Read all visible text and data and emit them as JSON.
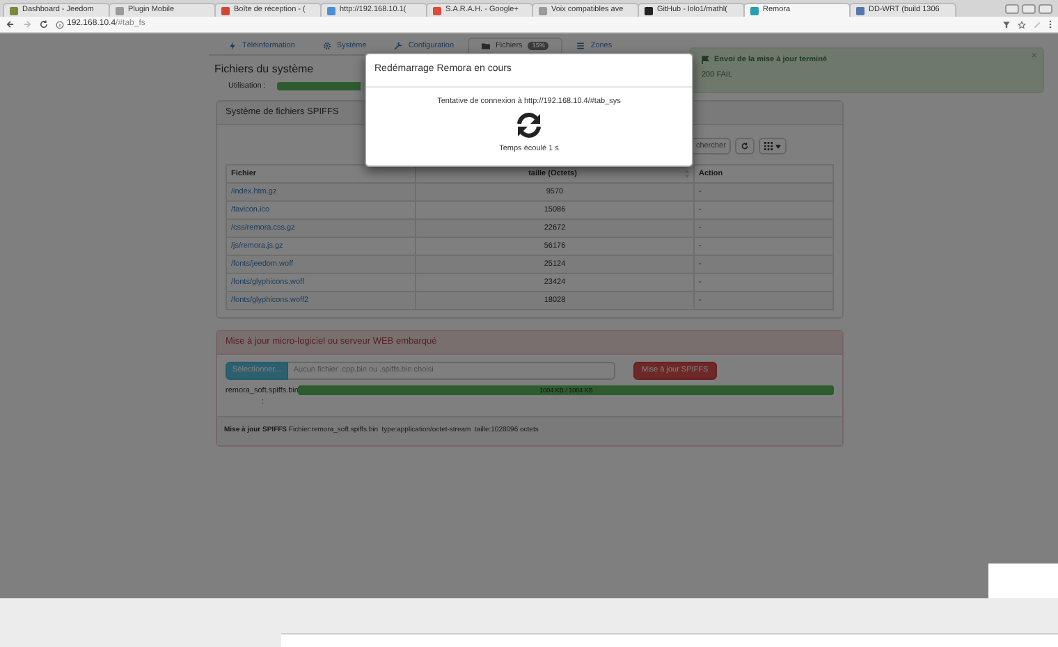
{
  "browser": {
    "tabs": [
      {
        "title": "Dashboard - Jeedom",
        "selected": false,
        "color": "#7a8a3a"
      },
      {
        "title": "Plugin Mobile",
        "selected": false,
        "color": "#9a9a9a"
      },
      {
        "title": "Boîte de réception - (",
        "selected": false,
        "color": "#d44638"
      },
      {
        "title": "http://192.168.10.1(",
        "selected": false,
        "color": "#4a90d9"
      },
      {
        "title": "S.A.R.A.H. - Google+",
        "selected": false,
        "color": "#dd4b39"
      },
      {
        "title": "Voix compatibles ave",
        "selected": false,
        "color": "#9a9a9a"
      },
      {
        "title": "GitHub - lolo1/mathl(",
        "selected": false,
        "color": "#222222"
      },
      {
        "title": "Remora",
        "selected": true,
        "color": "#2a9fb0"
      },
      {
        "title": "DD-WRT (build 1306",
        "selected": false,
        "color": "#5577aa"
      }
    ],
    "url_host": "192.168.10.4",
    "url_rest": "/#tab_fs"
  },
  "nav_tabs": [
    {
      "label": "Téléinformation",
      "selected": false,
      "kind": "bolt"
    },
    {
      "label": "Système",
      "selected": false,
      "kind": "gear"
    },
    {
      "label": "Configuration",
      "selected": false,
      "kind": "wrench"
    },
    {
      "label": "Fichiers",
      "selected": true,
      "kind": "folder",
      "badge": "15%"
    },
    {
      "label": "Zones",
      "selected": false,
      "kind": "list"
    }
  ],
  "alert": {
    "title": "Envoi de la mise à jour terminé",
    "message": "200 FAIL",
    "close": "×"
  },
  "heading": "Fichiers du système",
  "usage": {
    "label": "Utilisation :",
    "level": 0.15
  },
  "fs_panel": {
    "title": "Système de fichiers SPIFFS",
    "search_placeholder": "chercher",
    "columns": [
      "Fichier",
      "taille (Octets)",
      "Action"
    ],
    "rows": [
      {
        "file": "/index.htm.gz",
        "size": "9570",
        "action": "-"
      },
      {
        "file": "/favicon.ico",
        "size": "15086",
        "action": "-"
      },
      {
        "file": "/css/remora.css.gz",
        "size": "22672",
        "action": "-"
      },
      {
        "file": "/js/remora.js.gz",
        "size": "56176",
        "action": "-"
      },
      {
        "file": "/fonts/jeedom.woff",
        "size": "25124",
        "action": "-"
      },
      {
        "file": "/fonts/glyphicons.woff",
        "size": "23424",
        "action": "-"
      },
      {
        "file": "/fonts/glyphicons.woff2",
        "size": "18028",
        "action": "-"
      }
    ]
  },
  "update_panel": {
    "title": "Mise à jour micro-logiciel ou serveur WEB embarqué",
    "select_button": "Sélectionner...",
    "file_placeholder": "Aucun fichier .cpp.bin ou .spiffs.bin choisi",
    "submit_button": "Mise à jour SPIFFS",
    "upload": {
      "filename": "remora_soft.spiffs.bin",
      "level": 1,
      "reading": "1004 KB / 1004 KB",
      "separator": ":"
    },
    "footer": "**Mise à jour SPIFFS** Fichier:remora_soft.spiffs.bin  type:application/octet-stream  taille:1028096 octets"
  },
  "modal": {
    "title": "Redémarrage Remora en cours",
    "message": "Tentative de connexion à http://192.168.10.4/#tab_sys",
    "elapsed": "Temps écoulé 1 s"
  }
}
